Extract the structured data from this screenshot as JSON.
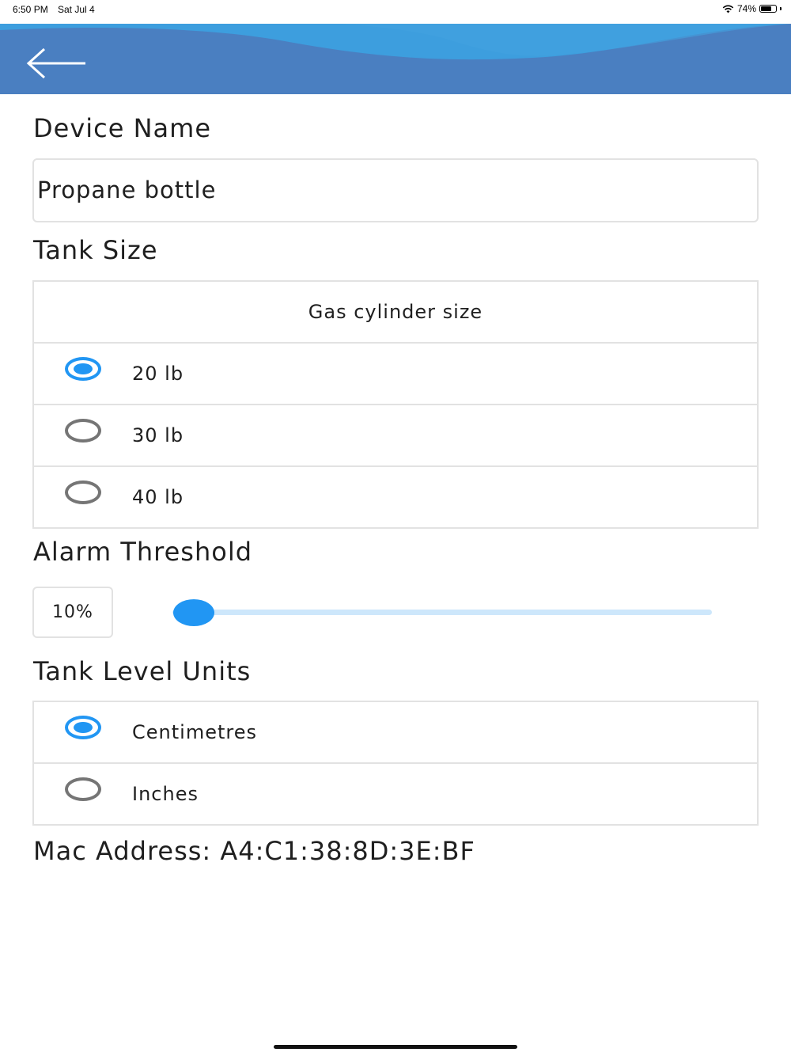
{
  "status_bar": {
    "time": "6:50 PM",
    "date": "Sat Jul 4",
    "battery": "74%",
    "battery_level": 0.74,
    "wifi_icon": "wifi-icon",
    "battery_icon": "battery-icon"
  },
  "header": {
    "back_icon": "arrow-left-icon",
    "colors": {
      "wave_dark": "#4a7fc1",
      "wave_light": "#3d9ede",
      "icon": "#ffffff"
    }
  },
  "device_name": {
    "label": "Device Name",
    "value": "Propane bottle"
  },
  "tank_size": {
    "label": "Tank Size",
    "group_title": "Gas cylinder size",
    "options": [
      {
        "label": "20 lb",
        "selected": true
      },
      {
        "label": "30 lb",
        "selected": false
      },
      {
        "label": "40 lb",
        "selected": false
      }
    ]
  },
  "alarm_threshold": {
    "label": "Alarm Threshold",
    "value_text": "10%",
    "value": 0.04
  },
  "tank_level_units": {
    "label": "Tank Level Units",
    "options": [
      {
        "label": "Centimetres",
        "selected": true
      },
      {
        "label": "Inches",
        "selected": false
      }
    ]
  },
  "mac_address": {
    "text": "Mac Address: A4:C1:38:8D:3E:BF"
  },
  "colors": {
    "accent": "#2196f3",
    "radio_unselected": "#757575",
    "border": "#e2e2e2",
    "slider_track": "#cde7fb"
  }
}
